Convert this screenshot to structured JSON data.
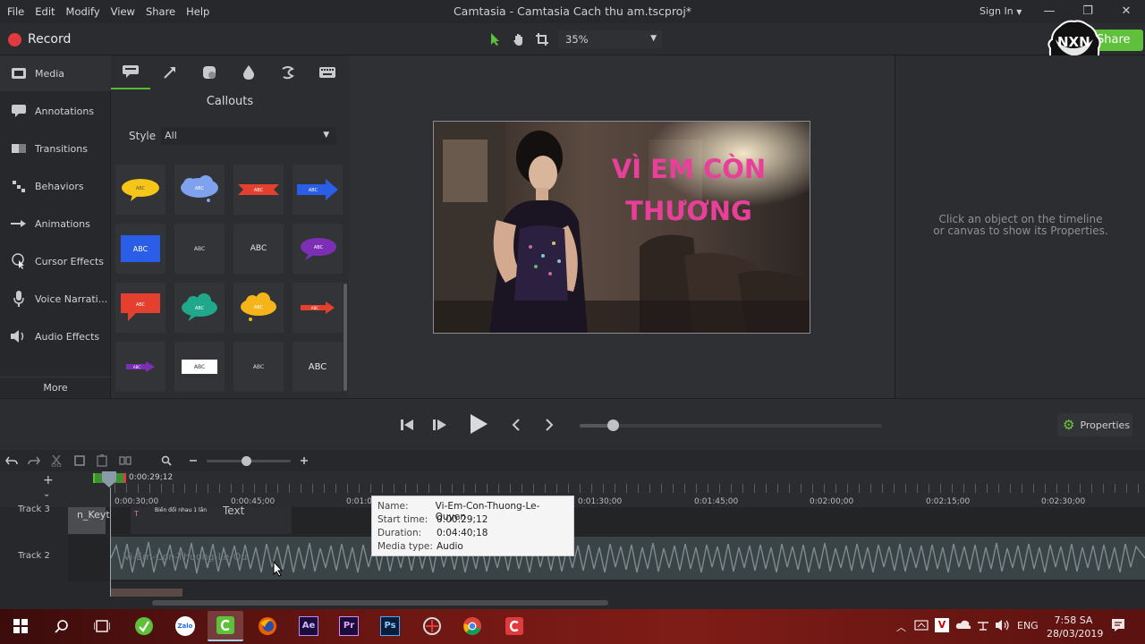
{
  "menu": [
    "File",
    "Edit",
    "Modify",
    "View",
    "Share",
    "Help"
  ],
  "window_title": "Camtasia - Camtasia Cach thu am.tscproj*",
  "sign_in": "Sign In",
  "window_controls": {
    "minimize": "—",
    "restore": "❐",
    "close": "✕"
  },
  "toolbar": {
    "record": "Record",
    "zoom": "35%",
    "share": "Share",
    "logo_text": "NXN"
  },
  "sidebar": {
    "items": [
      {
        "label": "Media",
        "icon": "media-icon"
      },
      {
        "label": "Annotations",
        "icon": "annotations-icon"
      },
      {
        "label": "Transitions",
        "icon": "transitions-icon"
      },
      {
        "label": "Behaviors",
        "icon": "behaviors-icon"
      },
      {
        "label": "Animations",
        "icon": "animations-icon"
      },
      {
        "label": "Cursor Effects",
        "icon": "cursor-effects-icon"
      },
      {
        "label": "Voice Narrati...",
        "icon": "microphone-icon"
      },
      {
        "label": "Audio Effects",
        "icon": "speaker-icon"
      }
    ],
    "more": "More"
  },
  "panel": {
    "title": "Callouts",
    "style_label": "Style",
    "style_value": "All",
    "callout_text": "ABC"
  },
  "canvas": {
    "title_line1": "VÌ EM CÒN",
    "title_line2": "THƯƠNG",
    "title_color": "#e8409a"
  },
  "properties": {
    "message_line1": "Click an object on the timeline",
    "message_line2": "or canvas to show its Properties.",
    "button": "Properties"
  },
  "playback": {
    "scrubber_position": 0.11
  },
  "timeline": {
    "playhead_time": "0:00:29;12",
    "ticks": [
      "0:00:30;00",
      "0:00:45;00",
      "0:01:0",
      "0:01:30;00",
      "0:01:45;00",
      "0:02:00;00",
      "0:02:15;00",
      "0:02:30;00"
    ],
    "tracks": [
      {
        "label": "Track 3",
        "clip_text_1": "n_Keyt",
        "clip_text_2": "Biến đổi nhau 1 lần",
        "clip_text_3": "Text",
        "clip_marker": "T"
      },
      {
        "label": "Track 2",
        "clip_text": "Vi-Em-Con-Thuong-Le-Qu"
      }
    ]
  },
  "tooltip": {
    "name_label": "Name:",
    "name": "Vi-Em-Con-Thuong-Le-Quyen",
    "start_label": "Start time:",
    "start": "0:00:29;12",
    "duration_label": "Duration:",
    "duration": "0:04:40;18",
    "type_label": "Media type:",
    "type": "Audio"
  },
  "taskbar": {
    "apps": [
      "windows-start-icon",
      "search-icon",
      "task-view-icon",
      "greenshot-icon",
      "zalo-icon",
      "camtasia-icon",
      "firefox-icon",
      "after-effects-icon",
      "premiere-icon",
      "photoshop-icon",
      "app-icon",
      "chrome-icon",
      "camtasia-recorder-icon"
    ],
    "zalo_label": "Zalo",
    "ae_label": "Ae",
    "pr_label": "Pr",
    "ps_label": "Ps",
    "language": "ENG",
    "time": "7:58 SA",
    "date": "28/03/2019"
  }
}
